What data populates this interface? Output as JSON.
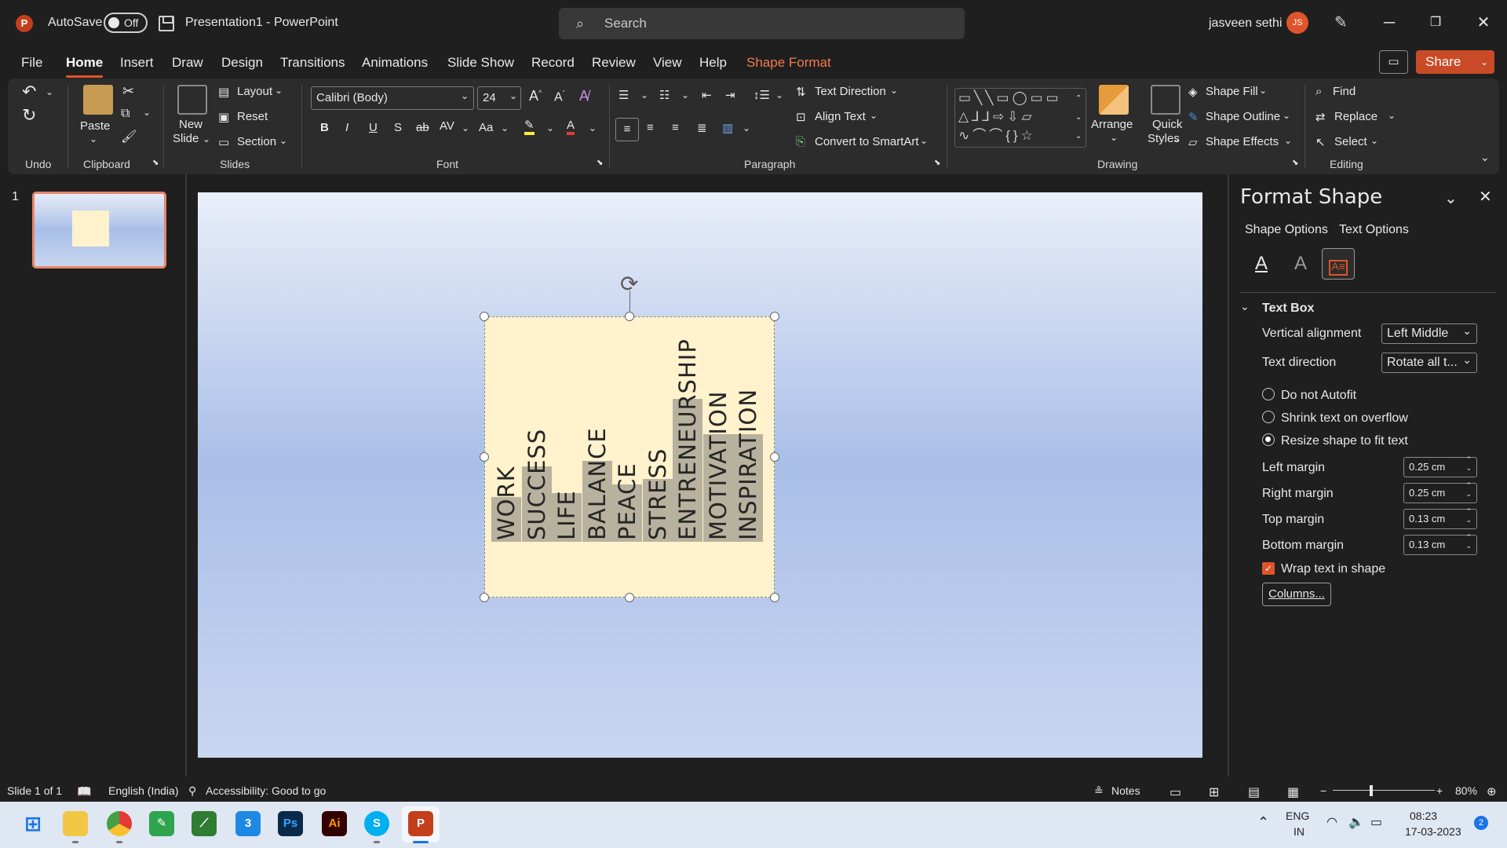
{
  "app": {
    "autosave_label": "AutoSave",
    "autosave_state": "Off",
    "doc_title": "Presentation1  -  PowerPoint",
    "search_placeholder": "Search",
    "user_name": "jasveen sethi",
    "user_initials": "JS",
    "share_label": "Share"
  },
  "tabs": [
    "File",
    "Home",
    "Insert",
    "Draw",
    "Design",
    "Transitions",
    "Animations",
    "Slide Show",
    "Record",
    "Review",
    "View",
    "Help",
    "Shape Format"
  ],
  "ribbon": {
    "groups": {
      "undo": "Undo",
      "clipboard": "Clipboard",
      "slides": "Slides",
      "font": "Font",
      "paragraph": "Paragraph",
      "drawing": "Drawing",
      "editing": "Editing"
    },
    "paste": "Paste",
    "new_slide_1": "New",
    "new_slide_2": "Slide",
    "layout": "Layout",
    "reset": "Reset",
    "section": "Section",
    "font_name": "Calibri (Body)",
    "font_size": "24",
    "text_direction": "Text Direction",
    "align_text": "Align Text",
    "convert_smartart": "Convert to SmartArt",
    "arrange": "Arrange",
    "quick_styles_1": "Quick",
    "quick_styles_2": "Styles",
    "shape_fill": "Shape Fill",
    "shape_outline": "Shape Outline",
    "shape_effects": "Shape Effects",
    "find": "Find",
    "replace": "Replace",
    "select": "Select"
  },
  "thumbnails": {
    "slide_number": "1"
  },
  "slide": {
    "words": [
      {
        "text": "WORK",
        "height": 0.25
      },
      {
        "text": "SUCCESS",
        "height": 0.42
      },
      {
        "text": "LIFE",
        "height": 0.27
      },
      {
        "text": "BALANCE",
        "height": 0.45
      },
      {
        "text": "PEACE",
        "height": 0.32
      },
      {
        "text": "STRESS",
        "height": 0.35
      },
      {
        "text": "ENTRENEURSHIP",
        "height": 0.8
      },
      {
        "text": "MOTIVATION",
        "height": 0.6
      },
      {
        "text": "INSPIRATION",
        "height": 0.6
      }
    ]
  },
  "format_pane": {
    "title": "Format Shape",
    "tab_shape": "Shape Options",
    "tab_text": "Text Options",
    "section": "Text Box",
    "vertical_alignment_label": "Vertical alignment",
    "vertical_alignment_value": "Left Middle",
    "text_direction_label": "Text direction",
    "text_direction_value": "Rotate all t...",
    "do_not_autofit": "Do not Autofit",
    "shrink_text": "Shrink text on overflow",
    "resize_shape": "Resize shape to fit text",
    "left_margin_label": "Left margin",
    "left_margin_value": "0.25 cm",
    "right_margin_label": "Right margin",
    "right_margin_value": "0.25 cm",
    "top_margin_label": "Top margin",
    "top_margin_value": "0.13 cm",
    "bottom_margin_label": "Bottom margin",
    "bottom_margin_value": "0.13 cm",
    "wrap_text": "Wrap text in shape",
    "columns_button": "Columns..."
  },
  "status": {
    "slide_of": "Slide 1 of 1",
    "language": "English (India)",
    "accessibility": "Accessibility: Good to go",
    "notes": "Notes",
    "zoom": "80%"
  },
  "taskbar": {
    "lang1": "ENG",
    "lang2": "IN",
    "time": "08:23",
    "date": "17-03-2023",
    "notif_count": "2"
  }
}
